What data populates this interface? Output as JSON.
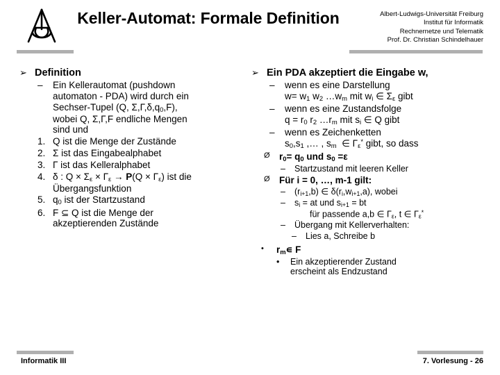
{
  "header": {
    "logo_name": "albert-ludwigs-universitaet-freiburg-logo",
    "title": "Keller-Automat: Formale Definition",
    "affiliation_lines": [
      "Albert-Ludwigs-Universität Freiburg",
      "Institut für Informatik",
      "Rechnernetze und Telematik",
      "Prof. Dr. Christian Schindelhauer"
    ]
  },
  "colors": {
    "text": "#000000",
    "background": "#ffffff",
    "divider_bar": "#b0b0b0"
  },
  "left_column": {
    "heading_marker": "➢",
    "heading": "Definition",
    "dash_marker": "–",
    "definition_lines": [
      "Ein Kellerautomat (pushdown",
      "automaton - PDA) wird durch ein",
      "Sechser-Tupel (Q, Σ,Γ,δ,q₀,F),",
      "wobei Q, Σ,Γ,F endliche Mengen",
      "sind und"
    ],
    "numbered_items": [
      {
        "number": "1.",
        "text": "Q ist die Menge der Zustände"
      },
      {
        "number": "2.",
        "text": "Σ ist das Eingabealphabet"
      },
      {
        "number": "3.",
        "text": "Γ ist das Kelleralphabet"
      },
      {
        "number": "4.",
        "text": "δ : Q × Σε × Γε → P(Q × Γε) ist die Übergangsfunktion"
      },
      {
        "number": "5.",
        "text": "q₀ ist der Startzustand"
      },
      {
        "number": "6.",
        "text": "F ⊆ Q ist die Menge der akzeptierenden Zustände"
      }
    ]
  },
  "right_column": {
    "heading_marker": "➢",
    "heading": "Ein PDA akzeptiert die Eingabe w,",
    "dash_marker": "–",
    "oe_marker": "Ø",
    "dot_marker": "•",
    "conditions": [
      {
        "line1": "wenn es eine Darstellung",
        "line2": "w= w₁ w₂ …wₘ mit wᵢ ∈ Σε gibt"
      },
      {
        "line1": "wenn es eine Zustandsfolge",
        "line2": "q = r₀ r₂ …rₘ mit sᵢ ∈ Q gibt"
      },
      {
        "line1": "wenn es Zeichenketten",
        "line2": "s₀,s₁ ,… , sₘ  ∈ Γε* gibt, so dass"
      }
    ],
    "start_condition": "r₀= q₀ und s₀ =ε",
    "start_condition_sub": "Startzustand mit leeren Keller",
    "induction_heading": "Für i = 0, …, m-1 gilt:",
    "induction_items": [
      "(rᵢ₊₁,b) ∈ δ(rᵢ,wᵢ₊₁,a), wobei",
      "sᵢ = at und sᵢ₊₁ = bt"
    ],
    "induction_sub": "für passende a,b ∈ Γε, t ∈ Γε*",
    "transition_label": "Übergang mit Kellerverhalten:",
    "transition_detail": "Lies a, Schreibe b",
    "final_condition": "rₘ∈ F",
    "final_lines": [
      "Ein akzeptierender Zustand",
      "erscheint als Endzustand"
    ]
  },
  "footer": {
    "left": "Informatik III",
    "right": "7. Vorlesung - 26"
  }
}
